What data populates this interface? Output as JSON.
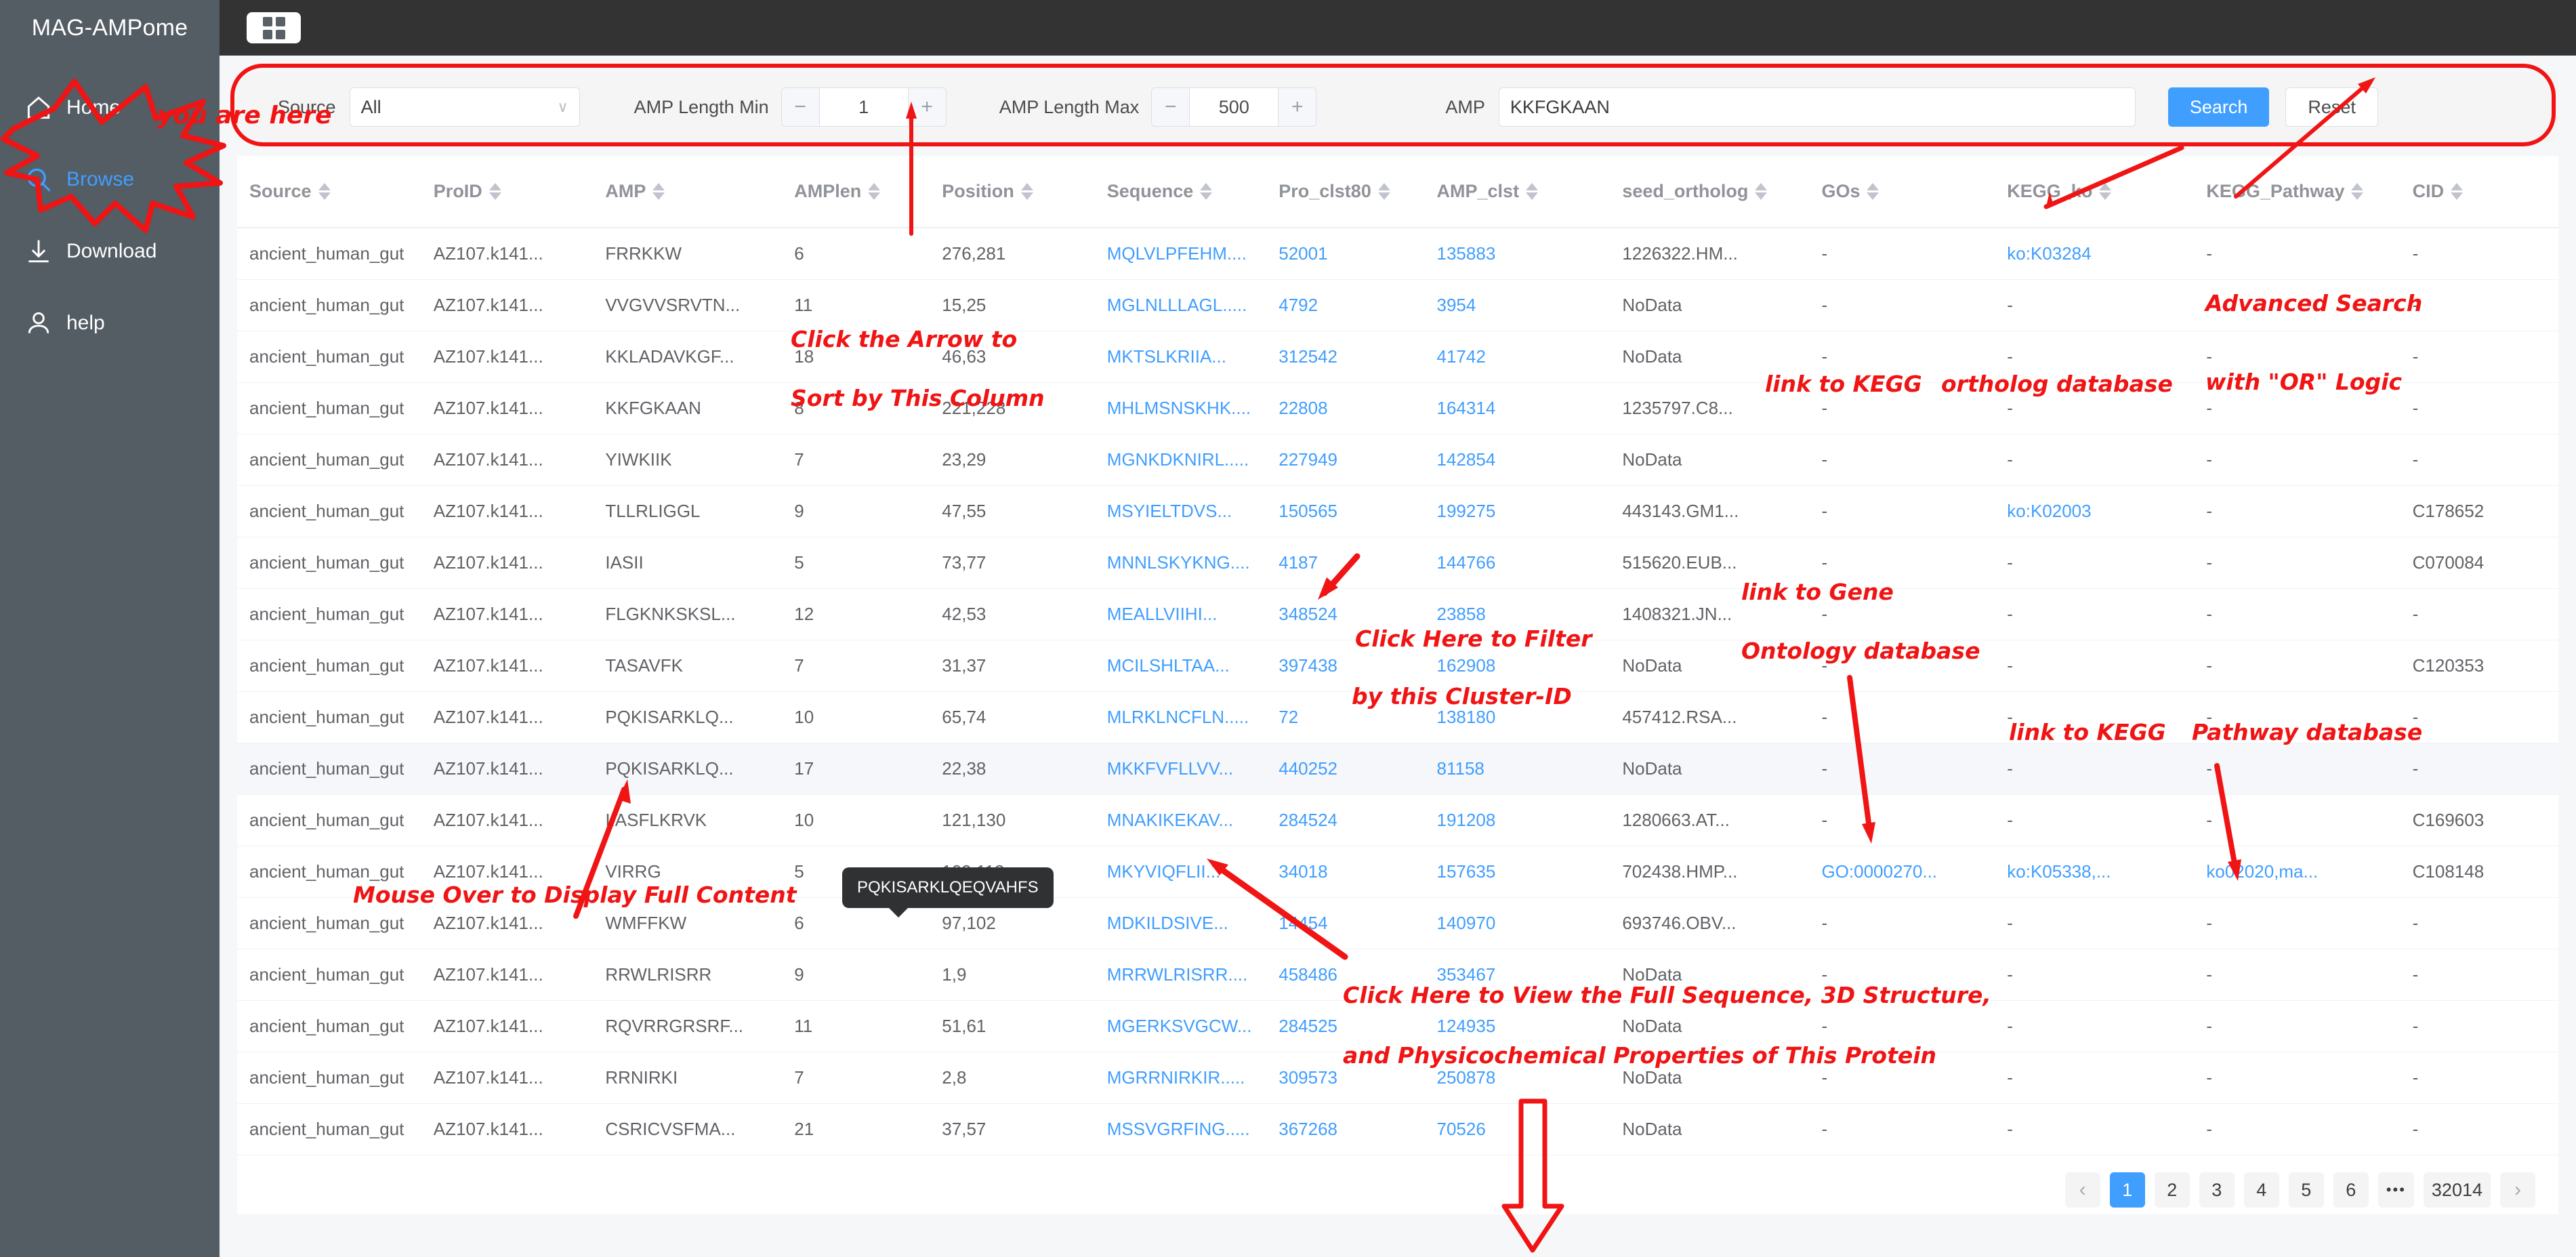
{
  "app": {
    "brand": "MAG-AMPome",
    "grid_icon": "grid-icon"
  },
  "sidebar": {
    "items": [
      {
        "label": "Home",
        "icon": "home-icon",
        "active": false
      },
      {
        "label": "Browse",
        "icon": "search-icon",
        "active": true
      },
      {
        "label": "Download",
        "icon": "download-icon",
        "active": false
      },
      {
        "label": "help",
        "icon": "user-icon",
        "active": false
      }
    ]
  },
  "search": {
    "source_label": "Source",
    "source_value": "All",
    "amp_len_min_label": "AMP Length Min",
    "amp_len_min_value": "1",
    "amp_len_max_label": "AMP Length Max",
    "amp_len_max_value": "500",
    "amp_label": "AMP",
    "amp_value": "KKFGKAAN",
    "minus": "−",
    "plus": "+",
    "search_button": "Search",
    "reset_button": "Reset"
  },
  "table": {
    "columns": [
      "Source",
      "ProID",
      "AMP",
      "AMPlen",
      "Position",
      "Sequence",
      "Pro_clst80",
      "AMP_clst",
      "seed_ortholog",
      "GOs",
      "KEGG_ko",
      "KEGG_Pathway",
      "CID"
    ],
    "rows": [
      {
        "source": "ancient_human_gut",
        "proid": "AZ107.k141...",
        "amp": "FRRKKW",
        "amplen": "6",
        "position": "276,281",
        "sequence": "MQLVLPFEHM....",
        "pro_clst80": "52001",
        "amp_clst": "135883",
        "seed_ortholog": "1226322.HM...",
        "gos": "-",
        "kegg_ko": "ko:K03284",
        "kegg_pathway": "-",
        "cid": "-"
      },
      {
        "source": "ancient_human_gut",
        "proid": "AZ107.k141...",
        "amp": "VVGVVSRVTN...",
        "amplen": "11",
        "position": "15,25",
        "sequence": "MGLNLLLAGL.....",
        "pro_clst80": "4792",
        "amp_clst": "3954",
        "seed_ortholog": "NoData",
        "gos": "-",
        "kegg_ko": "-",
        "kegg_pathway": "-",
        "cid": "-"
      },
      {
        "source": "ancient_human_gut",
        "proid": "AZ107.k141...",
        "amp": "KKLADAVKGF...",
        "amplen": "18",
        "position": "46,63",
        "sequence": "MKTSLKRIIA...",
        "pro_clst80": "312542",
        "amp_clst": "41742",
        "seed_ortholog": "NoData",
        "gos": "-",
        "kegg_ko": "-",
        "kegg_pathway": "-",
        "cid": "-"
      },
      {
        "source": "ancient_human_gut",
        "proid": "AZ107.k141...",
        "amp": "KKFGKAAN",
        "amplen": "8",
        "position": "221,228",
        "sequence": "MHLMSNSKHK....",
        "pro_clst80": "22808",
        "amp_clst": "164314",
        "seed_ortholog": "1235797.C8...",
        "gos": "-",
        "kegg_ko": "-",
        "kegg_pathway": "-",
        "cid": "-"
      },
      {
        "source": "ancient_human_gut",
        "proid": "AZ107.k141...",
        "amp": "YIWKIIK",
        "amplen": "7",
        "position": "23,29",
        "sequence": "MGNKDKNIRL.....",
        "pro_clst80": "227949",
        "amp_clst": "142854",
        "seed_ortholog": "NoData",
        "gos": "-",
        "kegg_ko": "-",
        "kegg_pathway": "-",
        "cid": "-"
      },
      {
        "source": "ancient_human_gut",
        "proid": "AZ107.k141...",
        "amp": "TLLRLIGGL",
        "amplen": "9",
        "position": "47,55",
        "sequence": "MSYIELTDVS...",
        "pro_clst80": "150565",
        "amp_clst": "199275",
        "seed_ortholog": "443143.GM1...",
        "gos": "-",
        "kegg_ko": "ko:K02003",
        "kegg_pathway": "-",
        "cid": "C178652"
      },
      {
        "source": "ancient_human_gut",
        "proid": "AZ107.k141...",
        "amp": "IASII",
        "amplen": "5",
        "position": "73,77",
        "sequence": "MNNLSKYKNG....",
        "pro_clst80": "4187",
        "amp_clst": "144766",
        "seed_ortholog": "515620.EUB...",
        "gos": "-",
        "kegg_ko": "-",
        "kegg_pathway": "-",
        "cid": "C070084"
      },
      {
        "source": "ancient_human_gut",
        "proid": "AZ107.k141...",
        "amp": "FLGKNKSKSL...",
        "amplen": "12",
        "position": "42,53",
        "sequence": "MEALLVIIHI...",
        "pro_clst80": "348524",
        "amp_clst": "23858",
        "seed_ortholog": "1408321.JN...",
        "gos": "-",
        "kegg_ko": "-",
        "kegg_pathway": "-",
        "cid": "-"
      },
      {
        "source": "ancient_human_gut",
        "proid": "AZ107.k141...",
        "amp": "TASAVFK",
        "amplen": "7",
        "position": "31,37",
        "sequence": "MCILSHLTAA...",
        "pro_clst80": "397438",
        "amp_clst": "162908",
        "seed_ortholog": "NoData",
        "gos": "-",
        "kegg_ko": "-",
        "kegg_pathway": "-",
        "cid": "C120353"
      },
      {
        "source": "ancient_human_gut",
        "proid": "AZ107.k141...",
        "amp": "PQKISARKLQ...",
        "amplen": "10",
        "position": "65,74",
        "sequence": "MLRKLNCFLN.....",
        "pro_clst80": "72",
        "amp_clst": "138180",
        "seed_ortholog": "457412.RSA...",
        "gos": "-",
        "kegg_ko": "-",
        "kegg_pathway": "-",
        "cid": "-"
      },
      {
        "source": "ancient_human_gut",
        "proid": "AZ107.k141...",
        "amp": "PQKISARKLQ...",
        "amplen": "17",
        "position": "22,38",
        "sequence": "MKKFVFLLVV...",
        "pro_clst80": "440252",
        "amp_clst": "81158",
        "seed_ortholog": "NoData",
        "gos": "-",
        "kegg_ko": "-",
        "kegg_pathway": "-",
        "cid": "-"
      },
      {
        "source": "ancient_human_gut",
        "proid": "AZ107.k141...",
        "amp": "IIASFLKRVK",
        "amplen": "10",
        "position": "121,130",
        "sequence": "MNAKIKEKAV...",
        "pro_clst80": "284524",
        "amp_clst": "191208",
        "seed_ortholog": "1280663.AT...",
        "gos": "-",
        "kegg_ko": "-",
        "kegg_pathway": "-",
        "cid": "C169603"
      },
      {
        "source": "ancient_human_gut",
        "proid": "AZ107.k141...",
        "amp": "VIRRG",
        "amplen": "5",
        "position": "109,113",
        "sequence": "MKYVIQFLII...",
        "pro_clst80": "34018",
        "amp_clst": "157635",
        "seed_ortholog": "702438.HMP...",
        "gos": "GO:0000270...",
        "kegg_ko": "ko:K05338,...",
        "kegg_pathway": "ko02020,ma...",
        "cid": "C108148"
      },
      {
        "source": "ancient_human_gut",
        "proid": "AZ107.k141...",
        "amp": "WMFFKW",
        "amplen": "6",
        "position": "97,102",
        "sequence": "MDKILDSIVE...",
        "pro_clst80": "14454",
        "amp_clst": "140970",
        "seed_ortholog": "693746.OBV...",
        "gos": "-",
        "kegg_ko": "-",
        "kegg_pathway": "-",
        "cid": "-"
      },
      {
        "source": "ancient_human_gut",
        "proid": "AZ107.k141...",
        "amp": "RRWLRISRR",
        "amplen": "9",
        "position": "1,9",
        "sequence": "MRRWLRISRR....",
        "pro_clst80": "458486",
        "amp_clst": "353467",
        "seed_ortholog": "NoData",
        "gos": "-",
        "kegg_ko": "-",
        "kegg_pathway": "-",
        "cid": "-"
      },
      {
        "source": "ancient_human_gut",
        "proid": "AZ107.k141...",
        "amp": "RQVRRGRSRF...",
        "amplen": "11",
        "position": "51,61",
        "sequence": "MGERKSVGCW...",
        "pro_clst80": "284525",
        "amp_clst": "124935",
        "seed_ortholog": "NoData",
        "gos": "-",
        "kegg_ko": "-",
        "kegg_pathway": "-",
        "cid": "-"
      },
      {
        "source": "ancient_human_gut",
        "proid": "AZ107.k141...",
        "amp": "RRNIRKI",
        "amplen": "7",
        "position": "2,8",
        "sequence": "MGRRNIRKIR.....",
        "pro_clst80": "309573",
        "amp_clst": "250878",
        "seed_ortholog": "NoData",
        "gos": "-",
        "kegg_ko": "-",
        "kegg_pathway": "-",
        "cid": "-"
      },
      {
        "source": "ancient_human_gut",
        "proid": "AZ107.k141...",
        "amp": "CSRICVSFMA...",
        "amplen": "21",
        "position": "37,57",
        "sequence": "MSSVGRFING.....",
        "pro_clst80": "367268",
        "amp_clst": "70526",
        "seed_ortholog": "NoData",
        "gos": "-",
        "kegg_ko": "-",
        "kegg_pathway": "-",
        "cid": "-"
      }
    ],
    "highlight_row_index": 10,
    "tooltip": "PQKISARKLQEQVAHFS"
  },
  "pagination": {
    "prev": "‹",
    "next": "›",
    "pages": [
      "1",
      "2",
      "3",
      "4",
      "5",
      "6"
    ],
    "ellipsis": "•••",
    "last_page": "32014",
    "current": "1"
  },
  "annotations": {
    "you_are_here": "you are here",
    "sort_column_l1": "Click the Arrow to",
    "sort_column_l2": "Sort by This Column",
    "advanced_search_l1": "Advanced Search",
    "advanced_search_l2": "with \"OR\" Logic",
    "kegg_ortholog_l1": "link to KEGG",
    "kegg_ortholog_l2": "ortholog database",
    "filter_cluster_l1": "Click Here to Filter",
    "filter_cluster_l2": "by this Cluster-ID",
    "gene_ontology_l1": "link to Gene",
    "gene_ontology_l2": "Ontology database",
    "kegg_pathway_l1": "link to KEGG",
    "kegg_pathway_l2": "Pathway database",
    "mouse_over": "Mouse Over to Display Full Content",
    "full_sequence_l1": "Click Here to View the Full Sequence, 3D Structure,",
    "full_sequence_l2": "and Physicochemical Properties of This Protein"
  },
  "colors": {
    "accent": "#409eff",
    "sidebar": "#545c64",
    "topbar": "#333333",
    "annotation": "#f01414"
  }
}
